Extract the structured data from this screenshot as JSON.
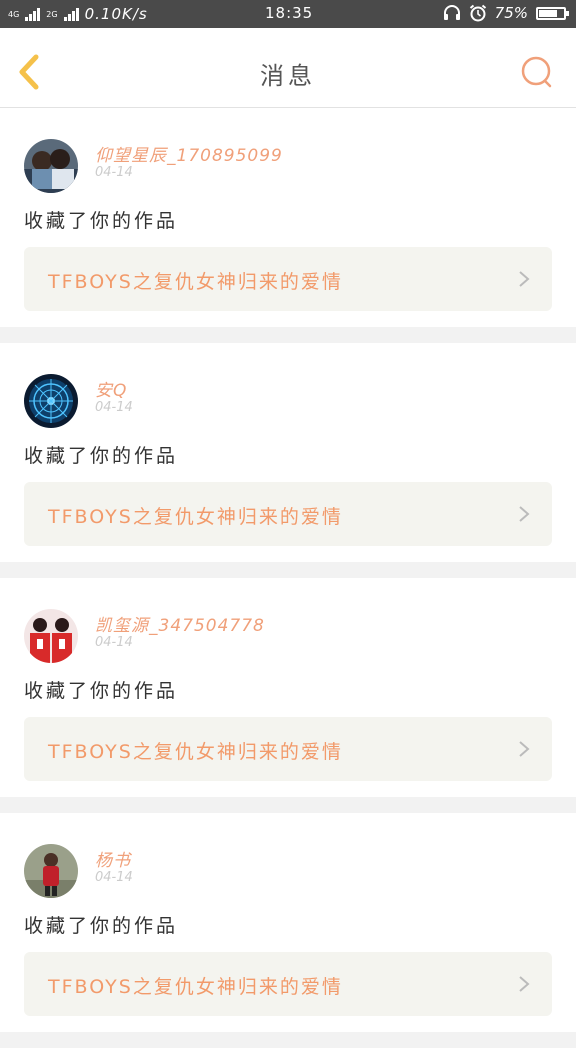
{
  "status_bar": {
    "network_left": "4G",
    "network_right": "4G",
    "network_2g": "2G",
    "speed": "0.10K/s",
    "time": "18:35",
    "battery_text": "75%",
    "battery_level": 0.75,
    "icons": [
      "headphones-icon",
      "alarm-icon",
      "battery-icon"
    ]
  },
  "header": {
    "title": "消息",
    "back_icon": "chevron-left-icon",
    "search_icon": "search-icon",
    "accent_color": "#f0a07a",
    "back_color": "#f5c14a"
  },
  "messages": [
    {
      "username": "仰望星辰_170895099",
      "date": "04-14",
      "action": "收藏了你的作品",
      "work": "TFBOYS之复仇女神归来的爱情",
      "avatar": "photo-couple"
    },
    {
      "username": "安Q",
      "date": "04-14",
      "action": "收藏了你的作品",
      "work": "TFBOYS之复仇女神归来的爱情",
      "avatar": "zodiac-wheel"
    },
    {
      "username": "凯玺源_347504778",
      "date": "04-14",
      "action": "收藏了你的作品",
      "work": "TFBOYS之复仇女神归来的爱情",
      "avatar": "photo-red-outfits"
    },
    {
      "username": "杨书",
      "date": "04-14",
      "action": "收藏了你的作品",
      "work": "TFBOYS之复仇女神归来的爱情",
      "avatar": "photo-child"
    }
  ]
}
